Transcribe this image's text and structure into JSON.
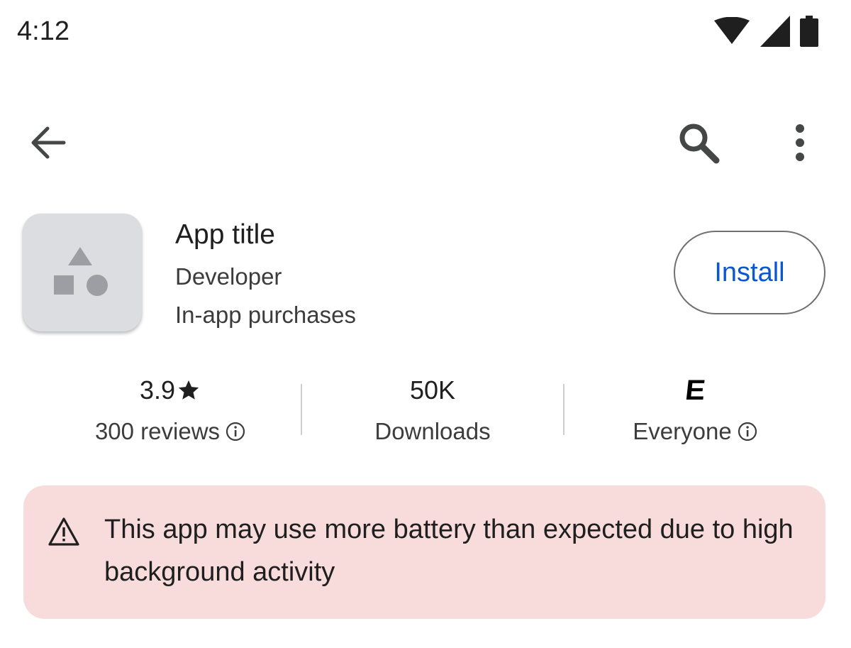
{
  "status_bar": {
    "time": "4:12",
    "icons": [
      "wifi-icon",
      "cellular-signal-icon",
      "battery-icon"
    ]
  },
  "app_bar": {
    "icons": [
      "arrow-back-icon",
      "search-icon",
      "more-vert-icon"
    ]
  },
  "app": {
    "title": "App title",
    "developer": "Developer",
    "purchases": "In-app purchases",
    "install_label": "Install",
    "icon": "placeholder-shapes-icon"
  },
  "stats": {
    "rating": {
      "value": "3.9",
      "icon": "star-icon",
      "label": "300 reviews",
      "info_icon": "info-icon"
    },
    "downloads": {
      "value": "50K",
      "label": "Downloads"
    },
    "content_rating": {
      "badge": "E",
      "label": "Everyone",
      "info_icon": "info-icon"
    }
  },
  "warning": {
    "icon": "warning-icon",
    "text": "This app may use more battery than expected due to high background activity"
  },
  "colors": {
    "accent": "#0b57d0",
    "warning_bg": "#f8dcdc",
    "icon_bg": "#dcdde0",
    "text_primary": "#1f1f1f",
    "text_secondary": "#3c3c3c"
  }
}
